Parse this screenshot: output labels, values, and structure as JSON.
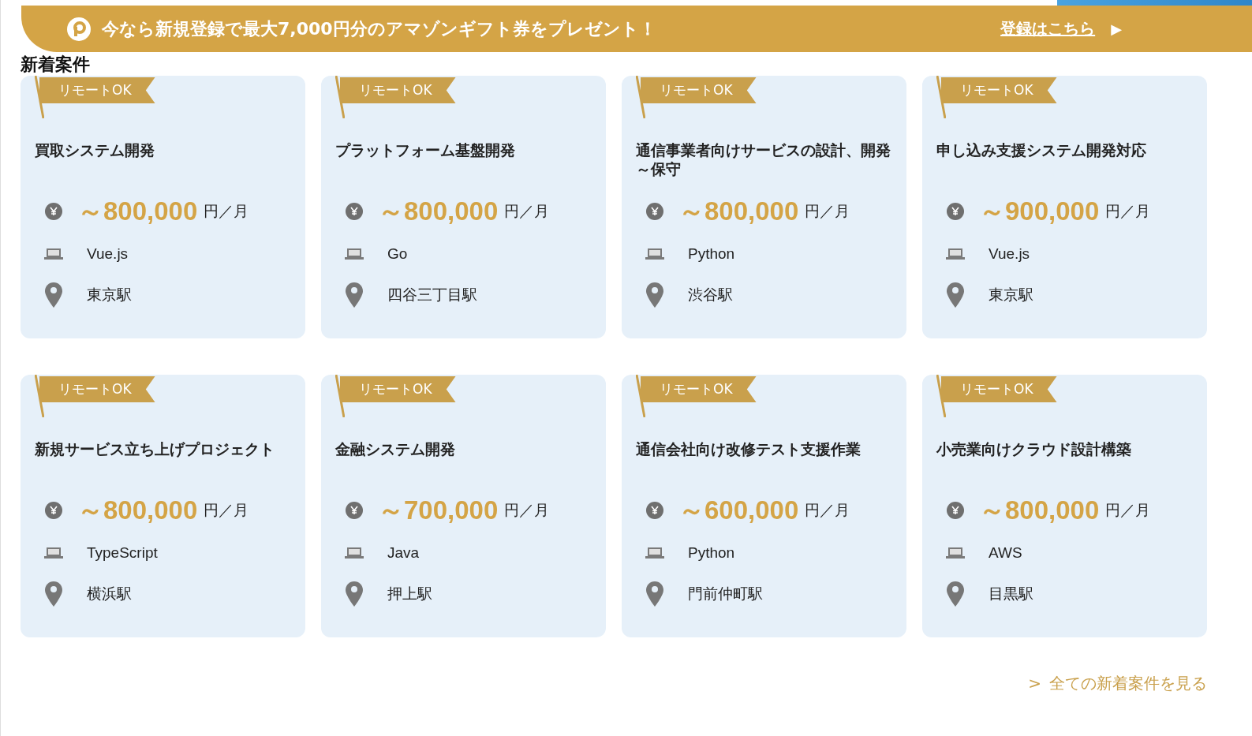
{
  "banner": {
    "message": "今なら新規登録で最大7,000円分のアマゾンギフト券をプレゼント！",
    "link": "登録はこちら",
    "arrow": "▶"
  },
  "heading": "新着案件",
  "jobs": [
    {
      "badge": "リモートOK",
      "title": "買取システム開発",
      "amount": "～800,000",
      "unit": "円／月",
      "skill": "Vue.js",
      "station": "東京駅"
    },
    {
      "badge": "リモートOK",
      "title": "プラットフォーム基盤開発",
      "amount": "～800,000",
      "unit": "円／月",
      "skill": "Go",
      "station": "四谷三丁目駅"
    },
    {
      "badge": "リモートOK",
      "title": "通信事業者向けサービスの設計、開発～保守",
      "amount": "～800,000",
      "unit": "円／月",
      "skill": "Python",
      "station": "渋谷駅"
    },
    {
      "badge": "リモートOK",
      "title": "申し込み支援システム開発対応",
      "amount": "～900,000",
      "unit": "円／月",
      "skill": "Vue.js",
      "station": "東京駅"
    },
    {
      "badge": "リモートOK",
      "title": "新規サービス立ち上げプロジェクト",
      "amount": "～800,000",
      "unit": "円／月",
      "skill": "TypeScript",
      "station": "横浜駅"
    },
    {
      "badge": "リモートOK",
      "title": "金融システム開発",
      "amount": "～700,000",
      "unit": "円／月",
      "skill": "Java",
      "station": "押上駅"
    },
    {
      "badge": "リモートOK",
      "title": "通信会社向け改修テスト支援作業",
      "amount": "～600,000",
      "unit": "円／月",
      "skill": "Python",
      "station": "門前仲町駅"
    },
    {
      "badge": "リモートOK",
      "title": "小売業向けクラウド設計構築",
      "amount": "～800,000",
      "unit": "円／月",
      "skill": "AWS",
      "station": "目黒駅"
    }
  ],
  "more_link": {
    "arrow": ">",
    "label": "全ての新着案件を見る"
  }
}
